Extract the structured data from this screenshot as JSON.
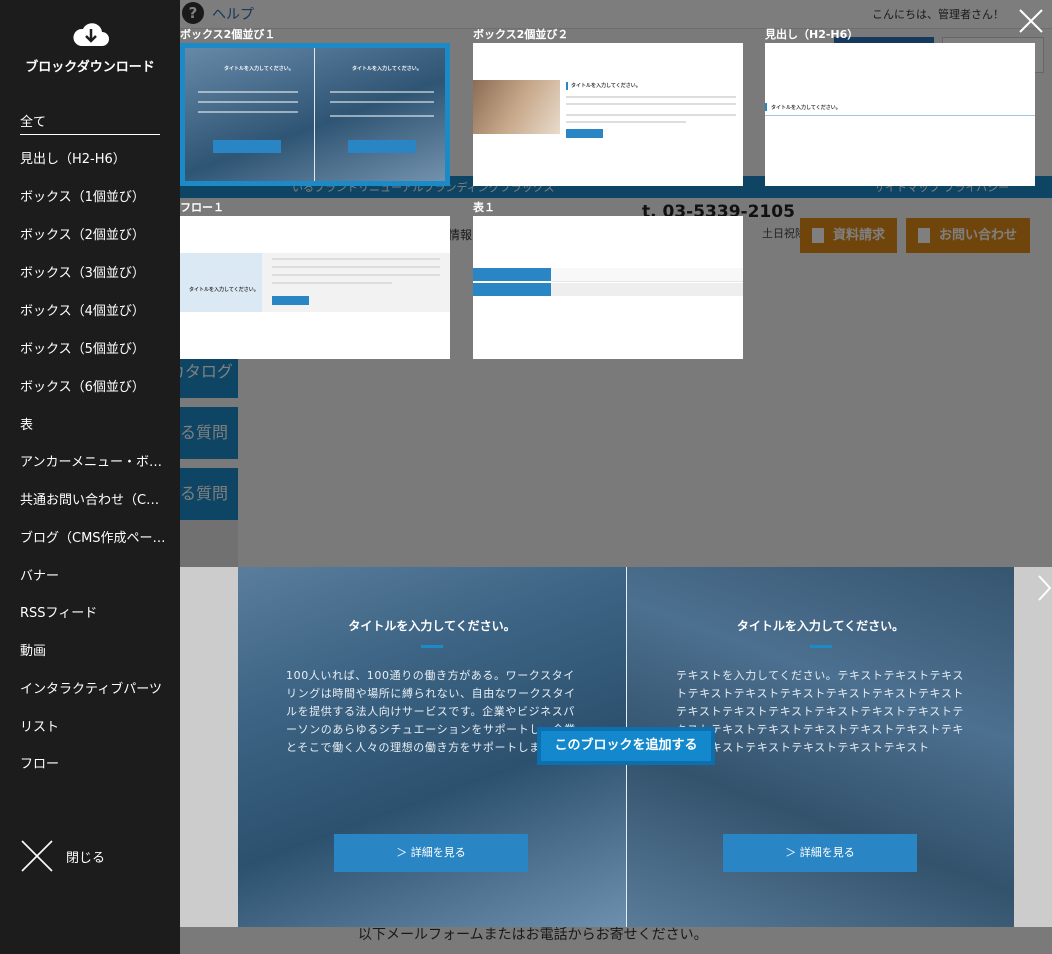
{
  "background": {
    "help_label": "ヘルプ",
    "greeting": "こんにちは、管理者さん！",
    "nav_left": "いるブランドリニューアルブランディングフラックス",
    "nav_right": "サイトマップ プライバシー",
    "phone": "t. 03-5339-2105",
    "hours": "土日祝除く",
    "news_tag": "情報",
    "btn_request": "資料請求",
    "btn_contact": "お問い合わせ",
    "side_btn1": "WEBカタログ",
    "side_btn2": "よくある質問",
    "side_btn3": "よくある質問",
    "footer_text": "以下メールフォームまたはお電話からお寄せください。"
  },
  "sidebar": {
    "title": "ブロックダウンロード",
    "categories": [
      "全て",
      "見出し（H2-H6）",
      "ボックス（1個並び）",
      "ボックス（2個並び）",
      "ボックス（3個並び）",
      "ボックス（4個並び）",
      "ボックス（5個並び）",
      "ボックス（6個並び）",
      "表",
      "アンカーメニュー・ボ…",
      "共通お問い合わせ（C…",
      "ブログ（CMS作成ペー…",
      "バナー",
      "RSSフィード",
      "動画",
      "インタラクティブパーツ",
      "リスト",
      "フロー"
    ],
    "close_label": "閉じる"
  },
  "tiles": [
    {
      "label": "ボックス2個並び１"
    },
    {
      "label": "ボックス2個並び２"
    },
    {
      "label": "見出し（H2-H6）"
    },
    {
      "label": "フロー１"
    },
    {
      "label": "表１"
    }
  ],
  "thumb_text": {
    "title": "タイトルを入力してください。",
    "btn": "＞ 詳細を見る"
  },
  "preview": {
    "left_title": "タイトルを入力してください。",
    "left_text": "100人いれば、100通りの働き方がある。ワークスタイリングは時間や場所に縛られない、自由なワークスタイルを提供する法人向けサービスです。企業やビジネスパーソンのあらゆるシチュエーションをサポートし、企業とそこで働く人々の理想の働き方をサポートします。",
    "left_button": "＞ 詳細を見る",
    "right_title": "タイトルを入力してください。",
    "right_text": "テキストを入力してください。テキストテキストテキストテキストテキストテキストテキストテキストテキストテキストテキストテキストテキストテキストテキストテキストテキストテキストテキストテキストテキストテキストテキストテキストテキストテキストテキスト",
    "right_button": "＞ 詳細を見る",
    "add_button": "このブロックを追加する"
  },
  "colors": {
    "accent": "#1d8ac8",
    "orange": "#e08a17",
    "sidebar_bg": "#1c1c1c"
  }
}
